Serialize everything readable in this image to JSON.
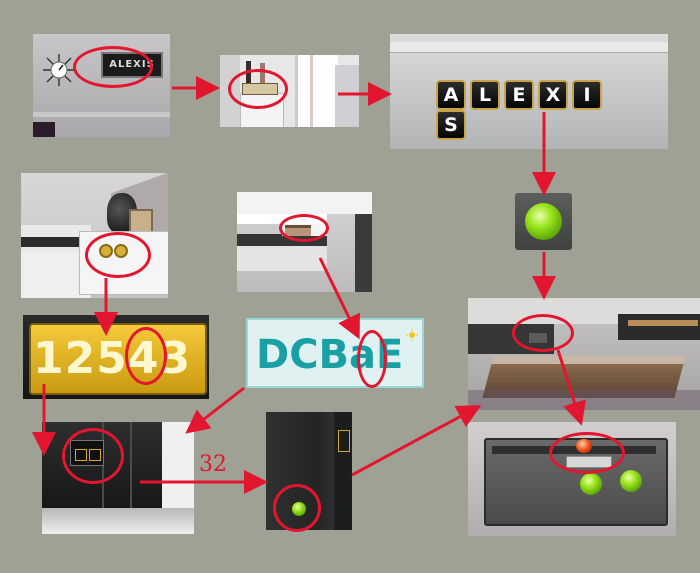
{
  "clock_display": "ALEXIS",
  "word_display": {
    "letters": [
      "A",
      "L",
      "E",
      "X",
      "I",
      "S"
    ]
  },
  "number_display": {
    "digits": [
      "1",
      "2",
      "5",
      "4",
      "3"
    ]
  },
  "code_display": {
    "text": "DCBaE"
  },
  "arrow_label": "32",
  "colors": {
    "arrow": "#e3162f",
    "highlight": "#e3162f",
    "background": "#9fa194",
    "green_button": "#8fdc1a"
  },
  "icons": [
    "wall-clock-icon",
    "sun-icon",
    "green-button-icon",
    "red-button-icon"
  ]
}
